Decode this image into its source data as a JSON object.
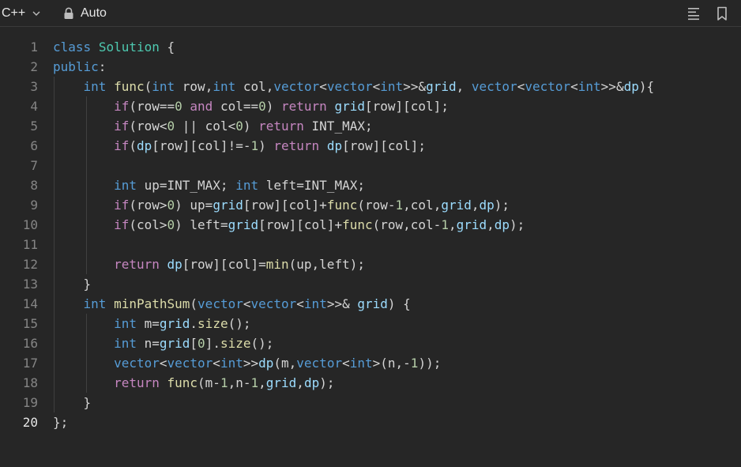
{
  "toolbar": {
    "language": "C++",
    "mode": "Auto",
    "icons": {
      "language_dropdown": "chevron-down-icon",
      "mode": "lock-icon",
      "format": "align-left-icon",
      "bookmark": "bookmark-icon"
    }
  },
  "editor": {
    "active_line": 20,
    "line_numbers": [
      "1",
      "2",
      "3",
      "4",
      "5",
      "6",
      "7",
      "8",
      "9",
      "10",
      "11",
      "12",
      "13",
      "14",
      "15",
      "16",
      "17",
      "18",
      "19",
      "20"
    ],
    "lines": [
      "class Solution {",
      "public:",
      "    int func(int row,int col,vector<vector<int>>&grid, vector<vector<int>>&dp){",
      "        if(row==0 and col==0) return grid[row][col];",
      "        if(row<0 || col<0) return INT_MAX;",
      "        if(dp[row][col]!=-1) return dp[row][col];",
      "",
      "        int up=INT_MAX; int left=INT_MAX;",
      "        if(row>0) up=grid[row][col]+func(row-1,col,grid,dp);",
      "        if(col>0) left=grid[row][col]+func(row,col-1,grid,dp);",
      "",
      "        return dp[row][col]=min(up,left);",
      "    }",
      "    int minPathSum(vector<vector<int>>& grid) {",
      "        int m=grid.size();",
      "        int n=grid[0].size();",
      "        vector<vector<int>>dp(m,vector<int>(n,-1));",
      "        return func(m-1,n-1,grid,dp);",
      "    }",
      "};"
    ]
  },
  "colors": {
    "background": "#262626",
    "keyword": "#c586c0",
    "type": "#569cd6",
    "function": "#dcdcaa",
    "variable": "#9cdcfe",
    "number": "#b5cea8",
    "class_name": "#4ec9b0",
    "line_number": "#858585"
  }
}
